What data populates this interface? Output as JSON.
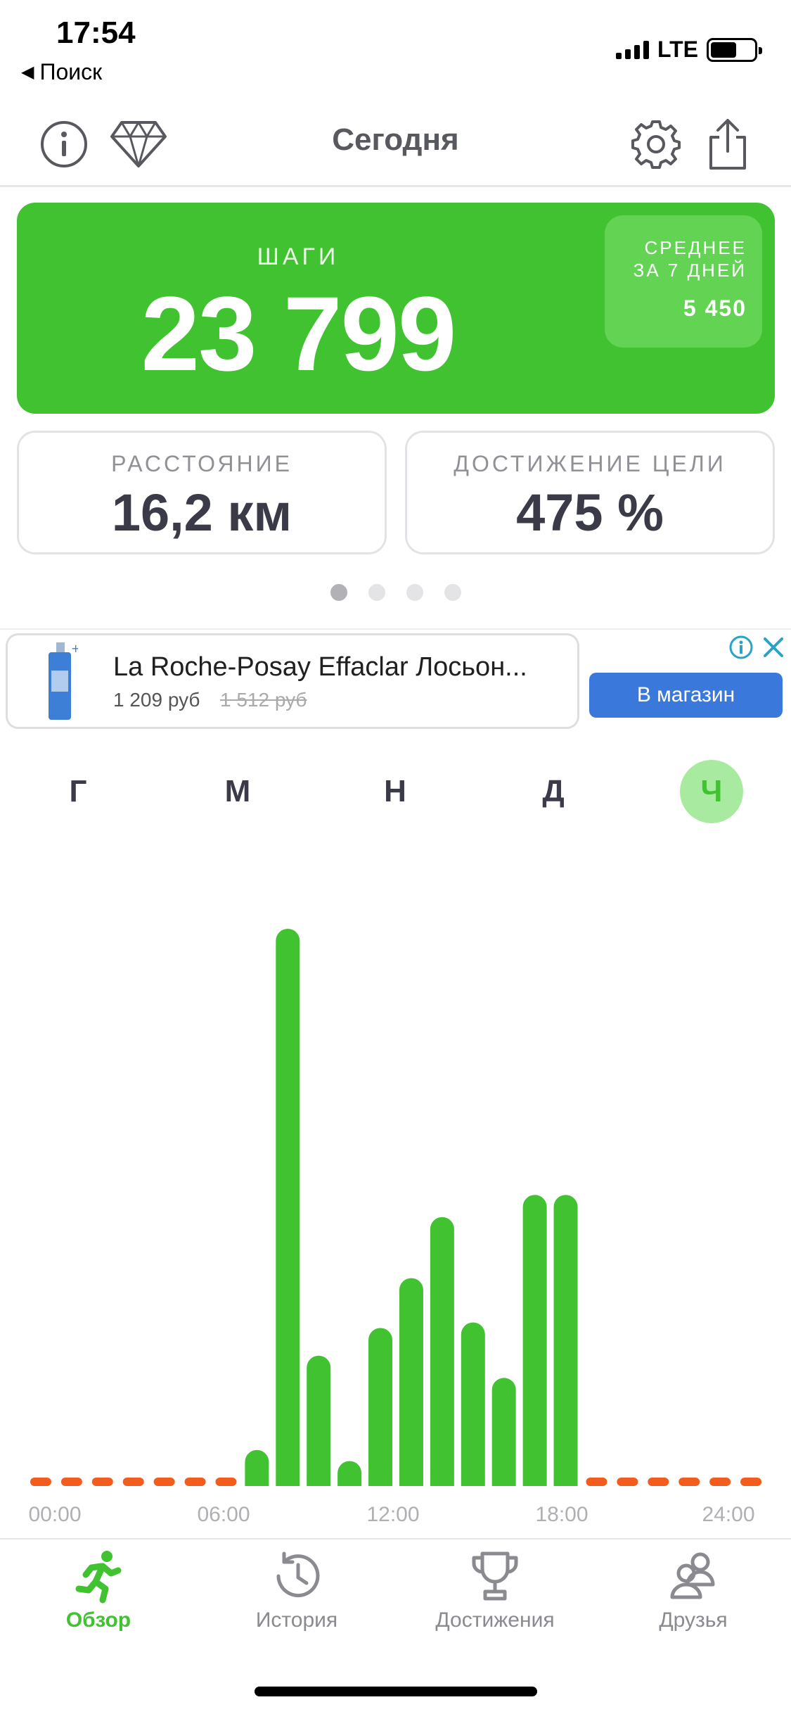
{
  "status_bar": {
    "time": "17:54",
    "back_label": "Поиск",
    "network": "LTE"
  },
  "header": {
    "title": "Сегодня"
  },
  "steps_card": {
    "label": "ШАГИ",
    "value": "23 799",
    "avg_label_line1": "СРЕДНЕЕ",
    "avg_label_line2": "ЗА 7 ДНЕЙ",
    "avg_value": "5 450",
    "color": "#41c231"
  },
  "stats": {
    "distance_label": "РАССТОЯНИЕ",
    "distance_value": "16,2 км",
    "goal_label": "ДОСТИЖЕНИЕ ЦЕЛИ",
    "goal_value": "475 %"
  },
  "pager": {
    "pages": 4,
    "active": 0
  },
  "ad": {
    "title": "La Roche-Posay Effaclar Лосьон...",
    "price": "1 209 руб",
    "old_price": "1 512 руб",
    "button": "В магазин"
  },
  "periods": [
    {
      "label": "Г",
      "active": false
    },
    {
      "label": "М",
      "active": false
    },
    {
      "label": "Н",
      "active": false
    },
    {
      "label": "Д",
      "active": false
    },
    {
      "label": "Ч",
      "active": true
    }
  ],
  "chart_data": {
    "type": "bar",
    "unit": "steps per hour (relative)",
    "x_ticks": [
      "00:00",
      "06:00",
      "12:00",
      "18:00",
      "24:00"
    ],
    "categories": [
      "0",
      "1",
      "2",
      "3",
      "4",
      "5",
      "6",
      "7",
      "8",
      "9",
      "10",
      "11",
      "12",
      "13",
      "14",
      "15",
      "16",
      "17",
      "18",
      "19",
      "20",
      "21",
      "22",
      "23"
    ],
    "values": [
      0,
      0,
      0,
      0,
      0,
      0,
      0,
      6,
      100,
      23,
      4,
      28,
      37,
      48,
      29,
      19,
      52,
      52,
      0,
      0,
      0,
      0,
      0,
      0
    ],
    "active_color": "#41c231",
    "inactive_color": "#f25c1c",
    "grid": false
  },
  "nav": {
    "items": [
      {
        "label": "Обзор",
        "icon": "running-person-icon",
        "active": true
      },
      {
        "label": "История",
        "icon": "history-clock-icon",
        "active": false
      },
      {
        "label": "Достижения",
        "icon": "trophy-icon",
        "active": false
      },
      {
        "label": "Друзья",
        "icon": "friends-icon",
        "active": false
      }
    ]
  }
}
